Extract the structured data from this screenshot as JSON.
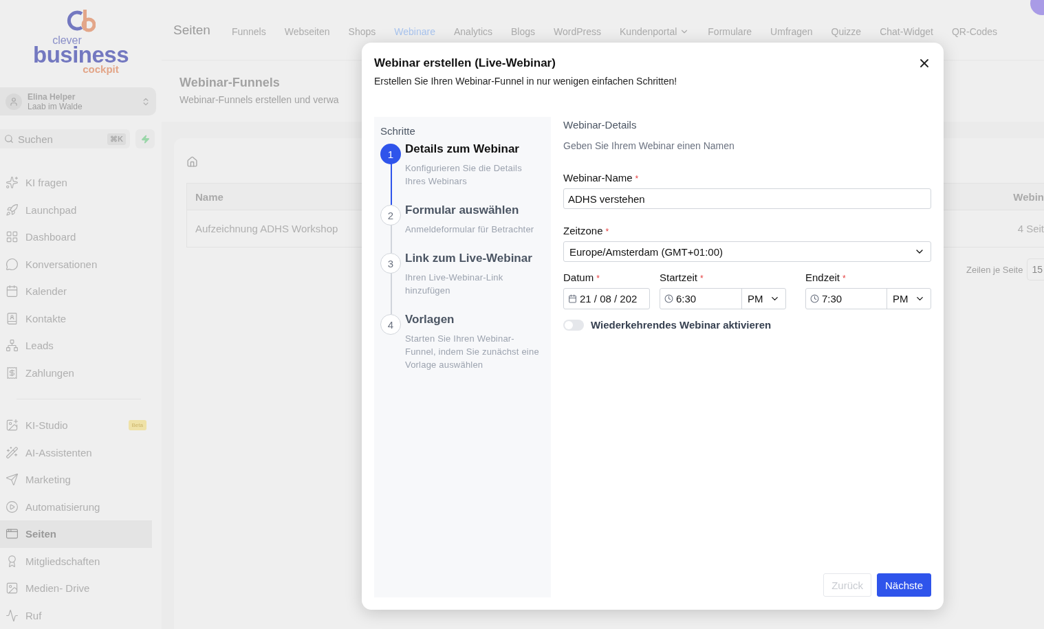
{
  "sidebar": {
    "logo": {
      "small": "clever",
      "main": "business",
      "sub": "cockpit"
    },
    "account": {
      "name": "Elina Helper",
      "place": "Laab im Walde"
    },
    "search": {
      "placeholder": "Suchen",
      "shortcut": "⌘K"
    },
    "groups": [
      [
        {
          "label": "KI fragen",
          "selected": false
        },
        {
          "label": "Launchpad",
          "selected": false
        },
        {
          "label": "Dashboard",
          "selected": false
        },
        {
          "label": "Konversationen",
          "selected": false
        },
        {
          "label": "Kalender",
          "selected": false
        },
        {
          "label": "Kontakte",
          "selected": false
        },
        {
          "label": "Leads",
          "selected": false
        },
        {
          "label": "Zahlungen",
          "selected": false
        }
      ],
      [
        {
          "label": "KI-Studio",
          "selected": false,
          "badge": "Beta"
        },
        {
          "label": "AI-Assistenten",
          "selected": false
        },
        {
          "label": "Marketing",
          "selected": false
        },
        {
          "label": "Automatisierung",
          "selected": false
        },
        {
          "label": "Seiten",
          "selected": true
        },
        {
          "label": "Mitgliedschaften",
          "selected": false
        },
        {
          "label": "Medien- Drive",
          "selected": false
        },
        {
          "label": "Ruf",
          "selected": false
        }
      ]
    ]
  },
  "topbar": {
    "title": "Seiten",
    "tabs": [
      {
        "label": "Funnels",
        "selected": false
      },
      {
        "label": "Webseiten",
        "selected": false
      },
      {
        "label": "Shops",
        "selected": false
      },
      {
        "label": "Webinare",
        "selected": true
      },
      {
        "label": "Analytics",
        "selected": false
      },
      {
        "label": "Blogs",
        "selected": false
      },
      {
        "label": "WordPress",
        "selected": false
      },
      {
        "label": "Kundenportal",
        "selected": false,
        "dropdown": true
      },
      {
        "label": "Formulare",
        "selected": false
      },
      {
        "label": "Umfragen",
        "selected": false
      },
      {
        "label": "Quizze",
        "selected": false
      },
      {
        "label": "Chat-Widget",
        "selected": false
      },
      {
        "label": "QR-Codes",
        "selected": false
      }
    ]
  },
  "page": {
    "title": "Webinar-Funnels",
    "subtitle": "Webinar-Funnels erstellen und verwa",
    "table": {
      "columns": [
        "Name",
        "Webin"
      ],
      "rows": [
        [
          "Aufzeichnung ADHS Workshop",
          "4 Seit"
        ]
      ]
    },
    "pagination": {
      "label": "Zeilen je Seite",
      "value": "15"
    }
  },
  "dialog": {
    "title": "Webinar erstellen (Live-Webinar)",
    "subtitle": "Erstellen Sie Ihren Webinar-Funnel in nur wenigen einfachen Schritten!",
    "steps_title": "Schritte",
    "steps": [
      {
        "number": "1",
        "title": "Details zum Webinar",
        "description": "Konfigurieren Sie die Details Ihres Webinars",
        "selected": true
      },
      {
        "number": "2",
        "title": "Formular auswählen",
        "description": "Anmeldeformular für Betrachter",
        "selected": false
      },
      {
        "number": "3",
        "title": "Link zum Live-Webinar",
        "description": "Ihren Live-Webinar-Link hinzufügen",
        "selected": false
      },
      {
        "number": "4",
        "title": "Vorlagen",
        "description": "Starten Sie Ihren Webinar-Funnel, indem Sie zunächst eine Vorlage auswählen",
        "selected": false
      }
    ],
    "section_title": "Webinar-Details",
    "section_hint": "Geben Sie Ihrem Webinar einen Namen",
    "name_field": {
      "label": "Webinar-Name",
      "required_mark": "*",
      "value": "ADHS verstehen"
    },
    "timezone_field": {
      "label": "Zeitzone",
      "required_mark": "*",
      "value": "Europe/Amsterdam (GMT+01:00)"
    },
    "date_field": {
      "label": "Datum",
      "required_mark": "*",
      "value": "21 / 08 / 202"
    },
    "start_field": {
      "label": "Startzeit",
      "required_mark": "*",
      "value": "6:30",
      "period": "PM"
    },
    "end_field": {
      "label": "Endzeit",
      "required_mark": "*",
      "value": "7:30",
      "period": "PM"
    },
    "recurring": {
      "label": "Wiederkehrendes Webinar aktivieren",
      "on": false
    },
    "buttons": [
      {
        "label": "Zurück",
        "kind": "secondary",
        "disabled": true
      },
      {
        "label": "Nächste",
        "kind": "primary",
        "disabled": false
      }
    ]
  }
}
